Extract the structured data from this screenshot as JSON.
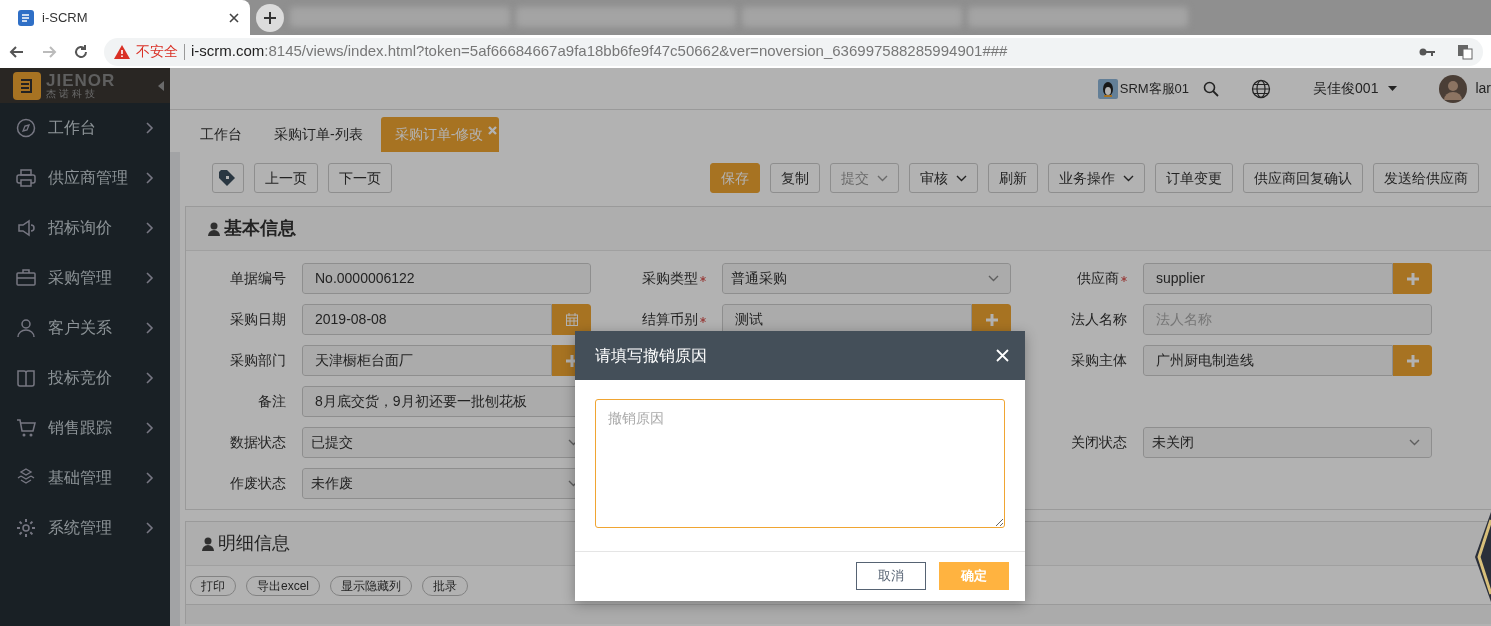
{
  "browser": {
    "tab": {
      "title": "i-SCRM"
    },
    "nav": [
      {
        "kind": "back",
        "disabled": false
      },
      {
        "kind": "forward",
        "disabled": true
      },
      {
        "kind": "reload",
        "disabled": false
      }
    ],
    "address": {
      "warning": "不安全",
      "host": "i-scrm.com",
      "path": ":8145/views/index.html?token=5af66684667a9fa18bb6fe9f47c50662&ver=noversion_636997588285994901###"
    }
  },
  "sidebar": {
    "logo": {
      "name": "JIENOR",
      "subtitle": "杰诺科技"
    },
    "items": [
      {
        "label": "工作台"
      },
      {
        "label": "供应商管理"
      },
      {
        "label": "招标询价"
      },
      {
        "label": "采购管理"
      },
      {
        "label": "客户关系"
      },
      {
        "label": "投标竞价"
      },
      {
        "label": "销售跟踪"
      },
      {
        "label": "基础管理"
      },
      {
        "label": "系统管理"
      }
    ]
  },
  "topbar": {
    "service": "SRM客服01",
    "user": "吴佳俊001",
    "user_cut": "lar"
  },
  "page_tabs": [
    {
      "label": "工作台",
      "selected": false
    },
    {
      "label": "采购订单-列表",
      "selected": false
    },
    {
      "label": "采购订单-修改",
      "selected": true
    }
  ],
  "nav_buttons": [
    "上一页",
    "下一页"
  ],
  "actions": [
    {
      "label": "保存",
      "kind": "primary",
      "disabled": false
    },
    {
      "label": "复制",
      "kind": "plain",
      "disabled": false
    },
    {
      "label": "提交",
      "kind": "dropdown",
      "disabled": true
    },
    {
      "label": "审核",
      "kind": "dropdown",
      "disabled": false
    },
    {
      "label": "刷新",
      "kind": "plain",
      "disabled": false
    },
    {
      "label": "业务操作",
      "kind": "dropdown",
      "disabled": false
    },
    {
      "label": "订单变更",
      "kind": "plain",
      "disabled": false
    },
    {
      "label": "供应商回复确认",
      "kind": "plain",
      "disabled": false
    },
    {
      "label": "发送给供应商",
      "kind": "plain",
      "disabled": false
    }
  ],
  "basic_info": {
    "title": "基本信息",
    "columns": [
      [
        {
          "label": "单据编号",
          "required": false,
          "kind": "text",
          "value": "No.0000006122"
        },
        {
          "label": "采购日期",
          "required": false,
          "kind": "date",
          "value": "2019-08-08"
        },
        {
          "label": "采购部门",
          "required": false,
          "kind": "lookup",
          "value": "天津橱柜台面厂"
        },
        {
          "label": "备注",
          "required": false,
          "kind": "text",
          "value": "8月底交货，9月初还要一批刨花板"
        },
        {
          "label": "数据状态",
          "required": false,
          "kind": "select",
          "value": "已提交"
        },
        {
          "label": "作废状态",
          "required": false,
          "kind": "select",
          "value": "未作废"
        }
      ],
      [
        {
          "label": "采购类型",
          "required": true,
          "kind": "select",
          "value": "普通采购"
        },
        {
          "label": "结算币别",
          "required": true,
          "kind": "lookup",
          "value": "测试"
        }
      ],
      [
        {
          "label": "供应商",
          "required": true,
          "kind": "lookup",
          "value": "supplier"
        },
        {
          "label": "法人名称",
          "required": false,
          "kind": "text",
          "placeholder": "法人名称"
        },
        {
          "label": "采购主体",
          "required": false,
          "kind": "lookup",
          "value": "广州厨电制造线"
        },
        {
          "label": "关闭状态",
          "required": false,
          "kind": "select",
          "value": "未关闭"
        }
      ]
    ]
  },
  "detail": {
    "title": "明细信息",
    "buttons": [
      "打印",
      "导出excel",
      "显示隐藏列",
      "批录"
    ]
  },
  "dialog": {
    "title": "请填写撤销原因",
    "placeholder": "撤销原因",
    "buttons": [
      {
        "label": "取消",
        "kind": "secondary"
      },
      {
        "label": "确定",
        "kind": "primary"
      }
    ]
  }
}
